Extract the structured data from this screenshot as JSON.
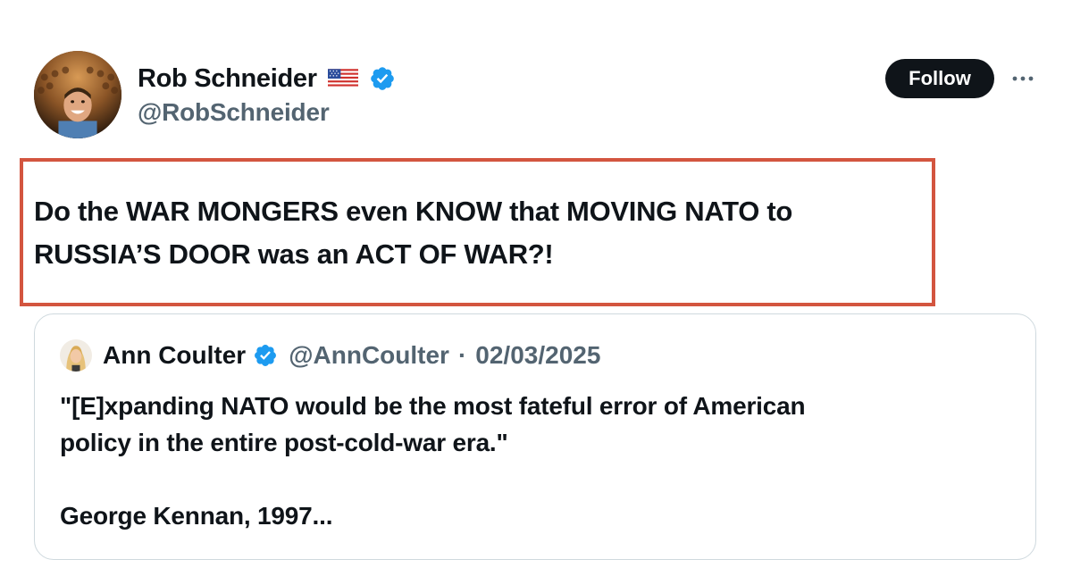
{
  "author": {
    "display_name": "Rob Schneider",
    "handle": "@RobSchneider",
    "flag_icon": "us-flag-icon",
    "verified_icon": "verified-badge-icon",
    "verified_color": "#1d9bf0"
  },
  "actions": {
    "follow_label": "Follow",
    "more_icon": "more-dots-icon"
  },
  "tweet": {
    "text": "Do the WAR MONGERS even KNOW that MOVING NATO to\nRUSSIA’S DOOR was an ACT OF WAR?!",
    "highlight_color": "#d3553f"
  },
  "quoted_tweet": {
    "display_name": "Ann Coulter",
    "handle": "@AnnCoulter",
    "separator": "·",
    "date": "02/03/2025",
    "text": "\"[E]xpanding NATO would be the most fateful error of American\npolicy in the entire post-cold-war era.\"\n\nGeorge Kennan, 1997..."
  },
  "colors": {
    "text_primary": "#0f1419",
    "text_secondary": "#536471",
    "border": "#cfd9de",
    "button_bg": "#0f1419"
  }
}
